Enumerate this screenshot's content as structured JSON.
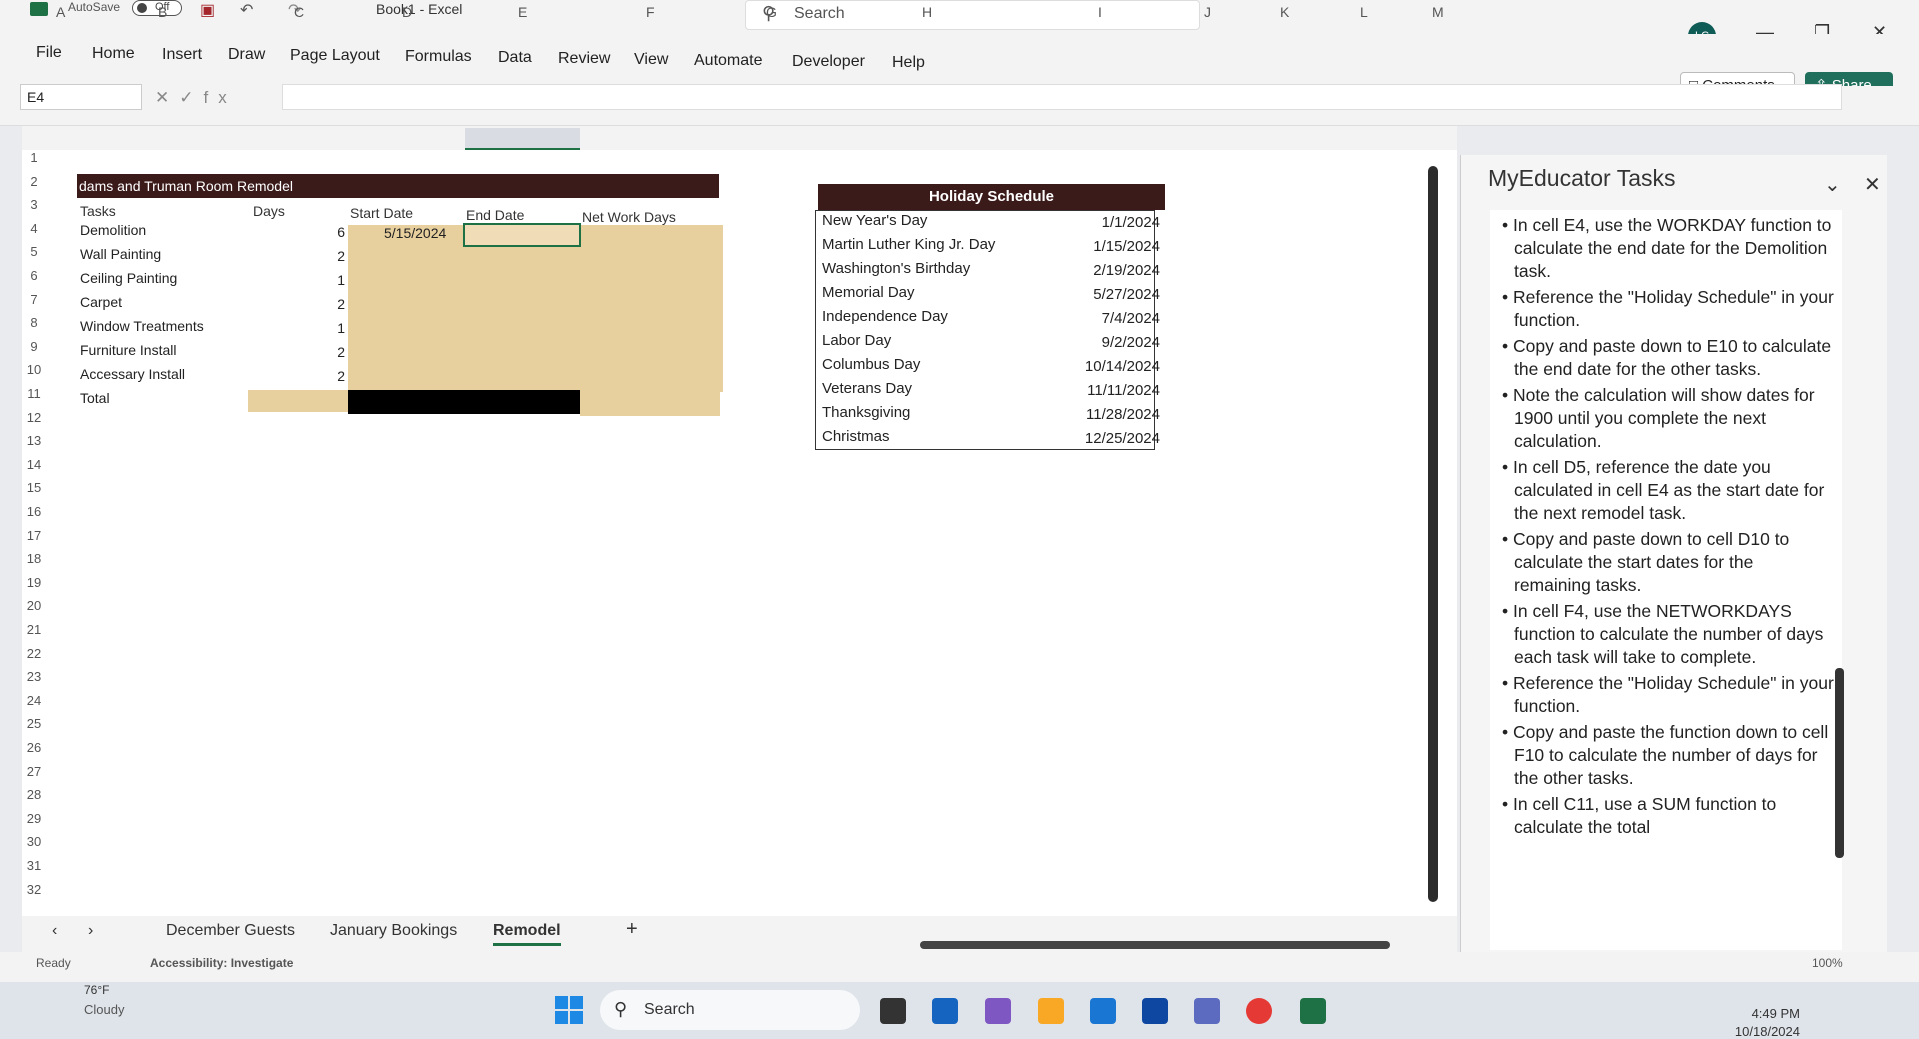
{
  "titlebar": {
    "autosave_label": "AutoSave",
    "autosave_state": "Off",
    "doc_title": "Book1 - Excel",
    "search_placeholder": "Search",
    "avatar_initials": "LC"
  },
  "ribbon": {
    "tabs": [
      "File",
      "Home",
      "Insert",
      "Draw",
      "Page Layout",
      "Formulas",
      "Data",
      "Review",
      "View",
      "Automate",
      "Developer",
      "Help"
    ],
    "comments_label": "Comments",
    "share_label": "Share"
  },
  "formula_bar": {
    "name_box": "E4",
    "formula": ""
  },
  "grid": {
    "columns": [
      "A",
      "B",
      "C",
      "D",
      "E",
      "F",
      "G",
      "H",
      "I",
      "J",
      "K",
      "L",
      "M"
    ],
    "rows": [
      "1",
      "2",
      "3",
      "4",
      "5",
      "6",
      "7",
      "8",
      "9",
      "10",
      "11",
      "12",
      "13",
      "14",
      "15",
      "16",
      "17",
      "18",
      "19",
      "20",
      "21",
      "22",
      "23",
      "24",
      "25",
      "26",
      "27",
      "28",
      "29",
      "30",
      "31",
      "32"
    ],
    "selected_cell": "E4"
  },
  "remodel_table": {
    "title": "dams and Truman Room Remodel",
    "headers": [
      "Tasks",
      "Days",
      "Start Date",
      "End Date",
      "Net Work Days"
    ],
    "rows": [
      {
        "task": "Demolition",
        "days": "6",
        "start": "5/15/2024"
      },
      {
        "task": "Wall Painting",
        "days": "2",
        "start": ""
      },
      {
        "task": "Ceiling Painting",
        "days": "1",
        "start": ""
      },
      {
        "task": "Carpet",
        "days": "2",
        "start": ""
      },
      {
        "task": "Window Treatments",
        "days": "1",
        "start": ""
      },
      {
        "task": "Furniture Install",
        "days": "2",
        "start": ""
      },
      {
        "task": "Accessary Install",
        "days": "2",
        "start": ""
      }
    ],
    "total_label": "Total"
  },
  "holiday_table": {
    "title": "Holiday Schedule",
    "rows": [
      {
        "name": "New Year's Day",
        "date": "1/1/2024"
      },
      {
        "name": "Martin Luther King Jr. Day",
        "date": "1/15/2024"
      },
      {
        "name": "Washington's Birthday",
        "date": "2/19/2024"
      },
      {
        "name": "Memorial Day",
        "date": "5/27/2024"
      },
      {
        "name": "Independence Day",
        "date": "7/4/2024"
      },
      {
        "name": "Labor Day",
        "date": "9/2/2024"
      },
      {
        "name": "Columbus Day",
        "date": "10/14/2024"
      },
      {
        "name": "Veterans Day",
        "date": "11/11/2024"
      },
      {
        "name": "Thanksgiving",
        "date": "11/28/2024"
      },
      {
        "name": "Christmas",
        "date": "12/25/2024"
      }
    ]
  },
  "sheets": {
    "tabs": [
      "December Guests",
      "January Bookings",
      "Remodel"
    ],
    "active": "Remodel",
    "add_label": "+"
  },
  "task_pane": {
    "title": "MyEducator Tasks",
    "items": [
      "In cell E4, use the WORKDAY function to calculate the end date for the Demolition task.",
      "Reference the \"Holiday Schedule\" in your function.",
      "Copy and paste down to E10 to calculate the end date for the other tasks.",
      "Note the calculation will show dates for 1900 until you complete the next calculation.",
      "In cell D5, reference the date you calculated in cell E4 as the start date for the next remodel task.",
      "Copy and paste down to cell D10 to calculate the start dates for the remaining tasks.",
      "In cell F4, use the NETWORKDAYS function to calculate the number of days each task will take to complete.",
      "Reference the \"Holiday Schedule\" in your function.",
      "Copy and paste the function down to cell F10 to calculate the number of days for the other tasks.",
      "In cell C11, use a SUM function to calculate the total"
    ]
  },
  "status_bar": {
    "ready": "Ready",
    "accessibility": "Accessibility: Investigate",
    "zoom": "100%"
  },
  "taskbar": {
    "temp": "76°F",
    "condition": "Cloudy",
    "search_label": "Search",
    "time": "4:49 PM",
    "date": "10/18/2024"
  },
  "colors": {
    "header_dark": "#3b1a1a",
    "tan_fill": "#e8cf9e",
    "excel_green": "#1e7145"
  }
}
